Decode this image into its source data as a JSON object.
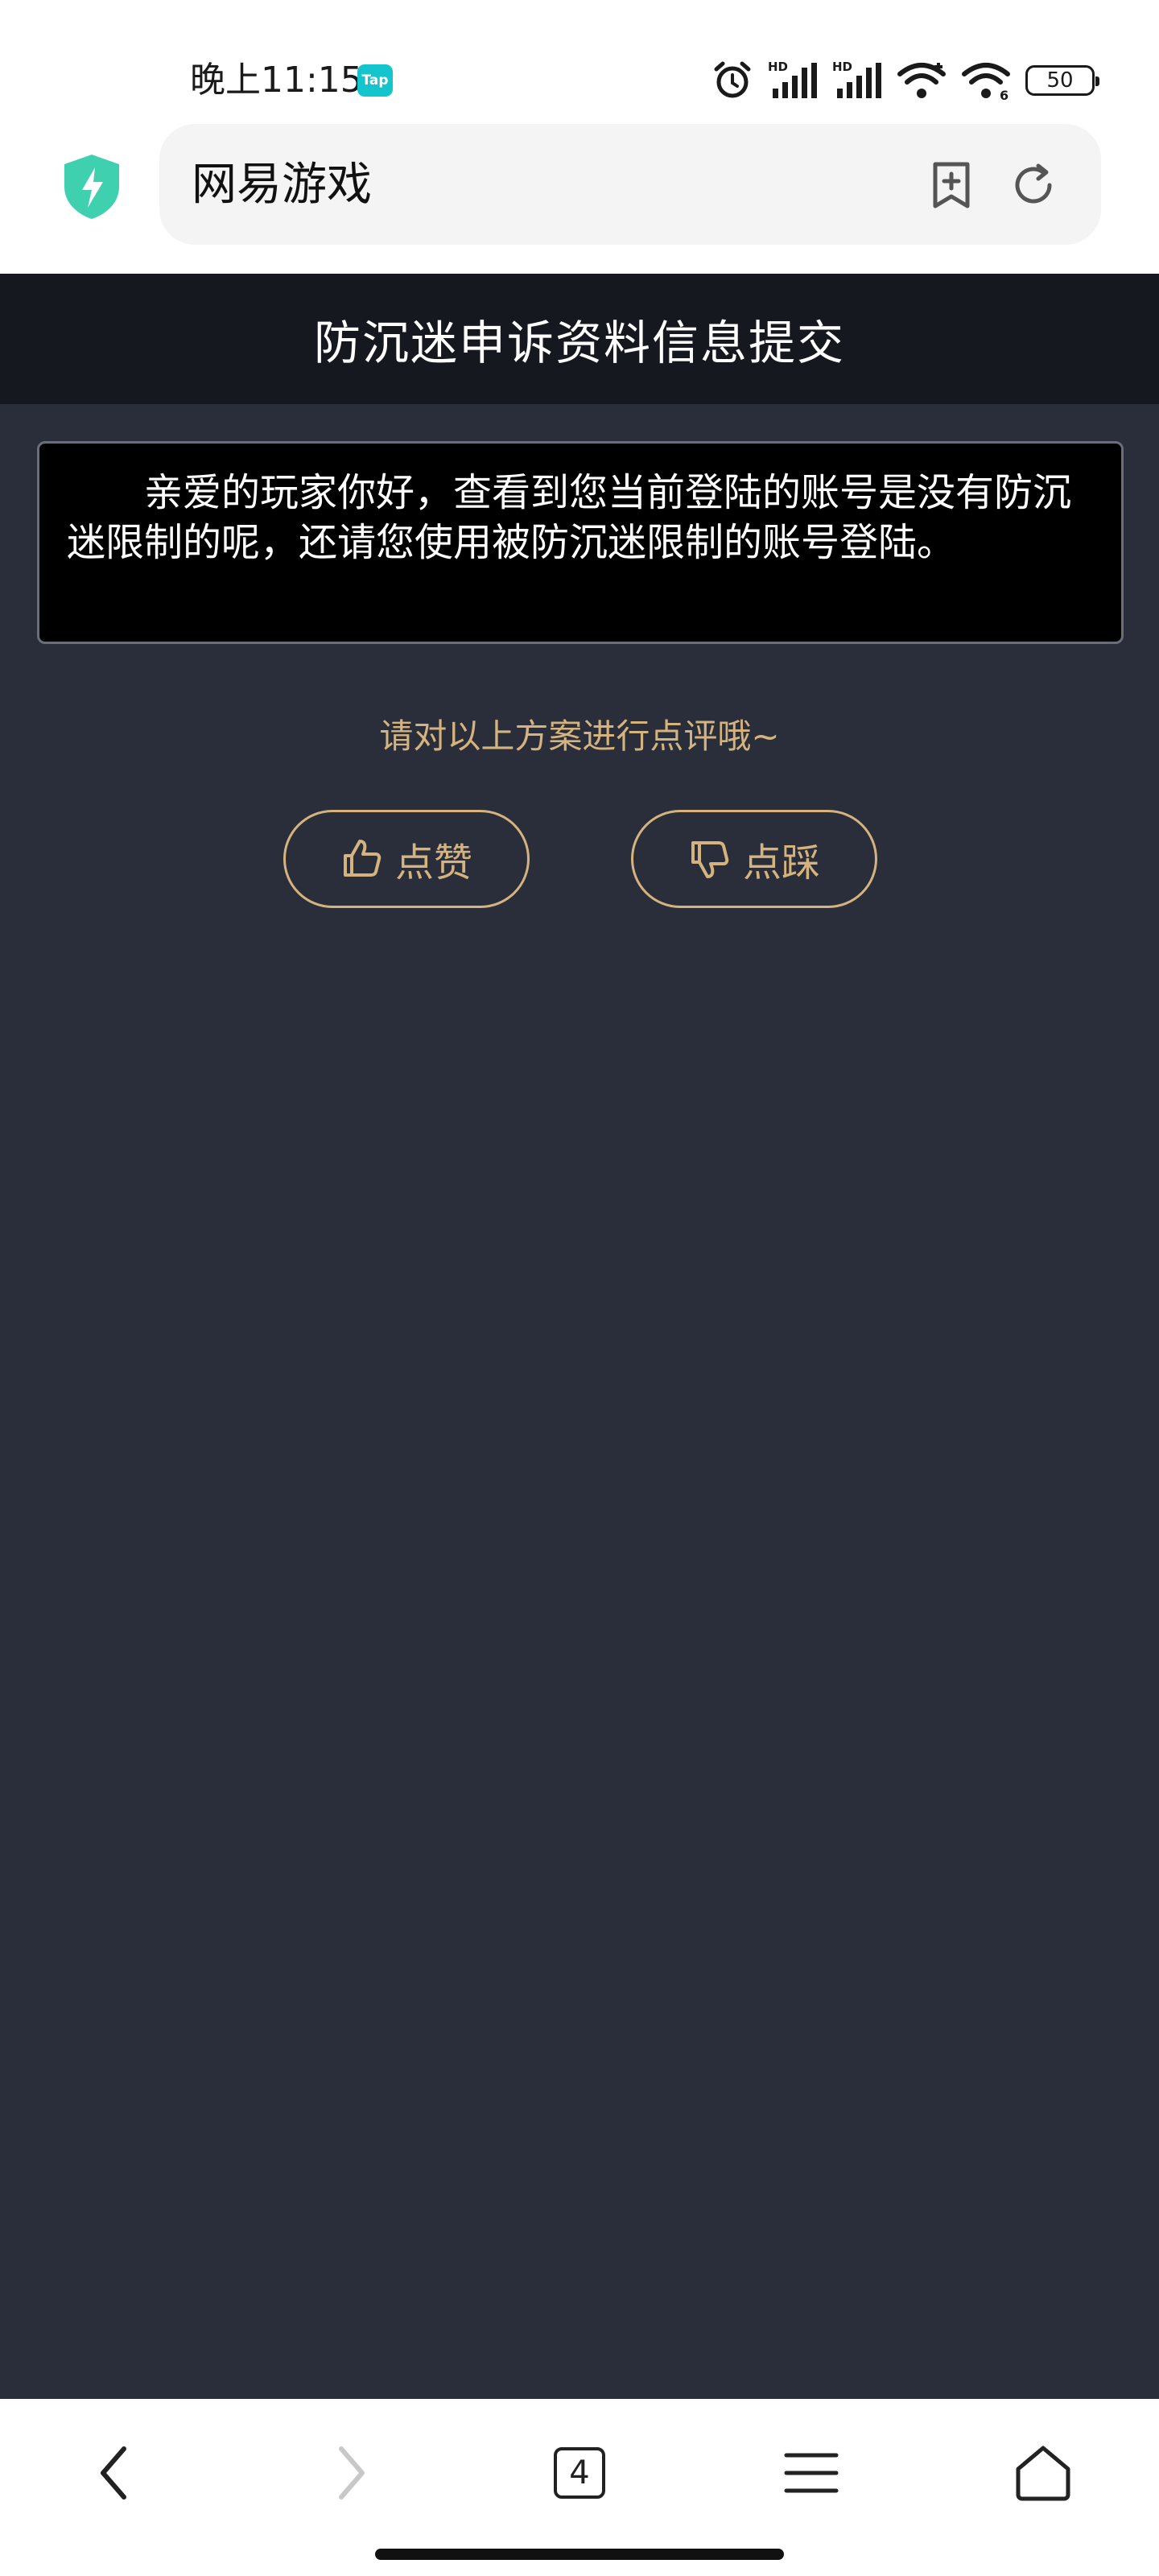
{
  "status_bar": {
    "time": "晚上11:15",
    "app_badge": "Tap",
    "battery": "50",
    "icons": [
      "alarm-icon",
      "signal-hd-icon",
      "signal-hd-icon",
      "wifi-icon",
      "wifi-6-icon",
      "battery-icon"
    ]
  },
  "browser": {
    "url_text": "网易游戏",
    "icons": [
      "shield-icon",
      "add-bookmark-icon",
      "reload-icon"
    ]
  },
  "page": {
    "title": "防沉迷申诉资料信息提交",
    "notice": "亲爱的玩家你好，查看到您当前登陆的账号是没有防沉迷限制的呢，还请您使用被防沉迷限制的账号登陆。",
    "rating_prompt": "请对以上方案进行点评哦~",
    "like_label": "点赞",
    "dislike_label": "点踩"
  },
  "bottom_nav": {
    "tab_count": "4",
    "icons": [
      "back-icon",
      "forward-icon",
      "tabs-icon",
      "menu-icon",
      "home-icon"
    ]
  },
  "colors": {
    "page_bg": "#2a2e3a",
    "header_bg": "#161820",
    "accent_gold": "#d4b37e",
    "shield": "#3fd0b0"
  }
}
